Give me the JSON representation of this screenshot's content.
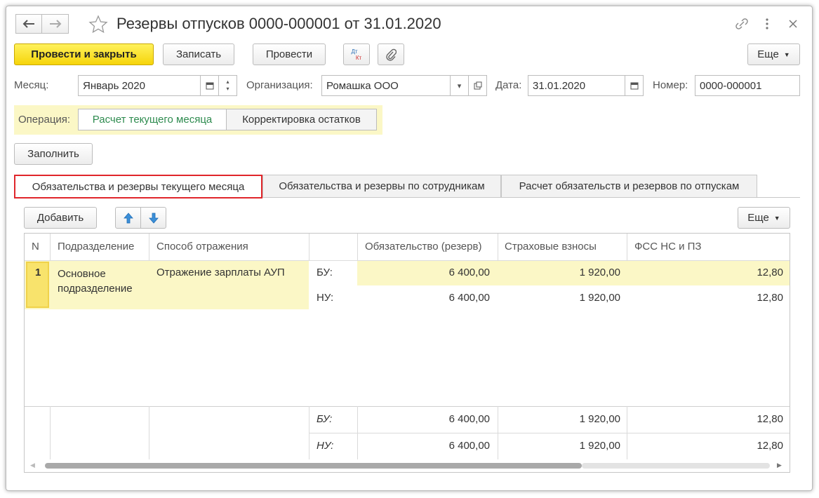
{
  "window": {
    "title": "Резервы отпусков 0000-000001 от 31.01.2020"
  },
  "toolbar": {
    "post_close_label": "Провести и закрыть",
    "save_label": "Записать",
    "post_label": "Провести",
    "dtkt_top": "Дт",
    "dtkt_bottom": "Кт",
    "more_label": "Еще"
  },
  "header": {
    "month_label": "Месяц:",
    "month_value": "Январь 2020",
    "org_label": "Организация:",
    "org_value": "Ромашка ООО",
    "date_label": "Дата:",
    "date_value": "31.01.2020",
    "number_label": "Номер:",
    "number_value": "0000-000001"
  },
  "operation": {
    "label": "Операция:",
    "options": [
      "Расчет текущего месяца",
      "Корректировка остатков"
    ]
  },
  "fill_label": "Заполнить",
  "tabs": [
    "Обязательства и резервы текущего месяца",
    "Обязательства и резервы по сотрудникам",
    "Расчет обязательств и резервов по отпускам"
  ],
  "table_toolbar": {
    "add_label": "Добавить",
    "more_label": "Еще"
  },
  "table": {
    "columns": [
      "N",
      "Подразделение",
      "Способ отражения",
      "",
      "Обязательство (резерв)",
      "Страховые взносы",
      "ФСС НС и ПЗ"
    ],
    "rows": [
      {
        "n": "1",
        "department": "Основное подразделение",
        "method": "Отражение зарплаты АУП",
        "bu_label": "БУ:",
        "nu_label": "НУ:",
        "bu": [
          "6 400,00",
          "1 920,00",
          "12,80"
        ],
        "nu": [
          "6 400,00",
          "1 920,00",
          "12,80"
        ]
      }
    ],
    "footer": {
      "bu_label": "БУ:",
      "nu_label": "НУ:",
      "bu": [
        "6 400,00",
        "1 920,00",
        "12,80"
      ],
      "nu": [
        "6 400,00",
        "1 920,00",
        "12,80"
      ]
    }
  },
  "colors": {
    "primary_button": "#f6d40a",
    "active_tab_border": "#e0262b",
    "row_highlight": "#fbf7c6",
    "selected_option_text": "#2e8b4f"
  }
}
